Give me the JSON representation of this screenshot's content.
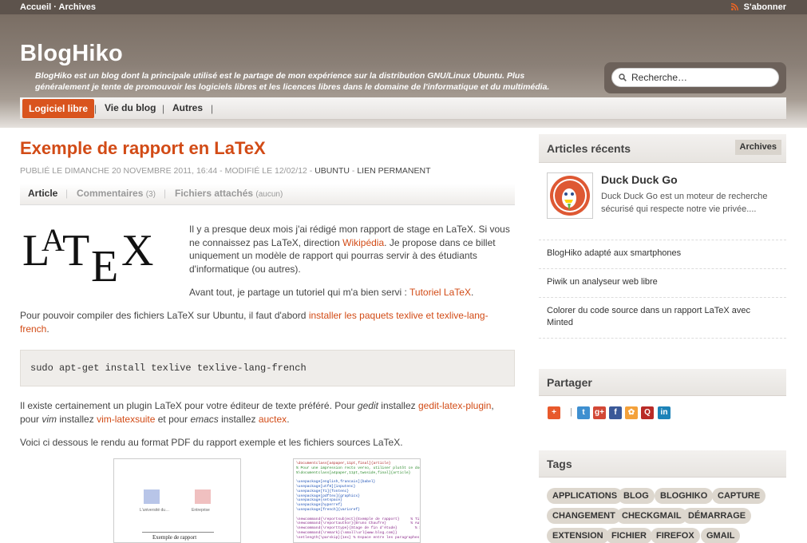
{
  "topbar": {
    "home": "Accueil",
    "dot": "·",
    "archives": "Archives",
    "subscribe": "S'abonner"
  },
  "header": {
    "title": "BlogHiko",
    "description": "BlogHiko est un blog dont la principale utilisé est le partage de mon expérience sur la distribution GNU/Linux Ubuntu. Plus généralement je tente de promouvoir les logiciels libres et les licences libres dans le domaine de l'informatique et du multimédia.",
    "search_placeholder": "Recherche…"
  },
  "nav": {
    "items": [
      "Logiciel libre",
      "Vie du blog",
      "Autres"
    ],
    "sep": "|"
  },
  "post": {
    "title": "Exemple de rapport en LaTeX",
    "meta_date": "Publié le dimanche 20 novembre 2011, 16:44 - Modifié le 12/02/12 -",
    "meta_category": "Ubuntu",
    "meta_dash": "-",
    "meta_permalink": "Lien permanent",
    "tabs": {
      "article": "Article",
      "comments": "Commentaires",
      "comments_count": "(3)",
      "files": "Fichiers attachés",
      "files_count": "(aucun)",
      "pipe": "|"
    },
    "logo_text": "LaTeX",
    "p1_a": "Il y a presque deux mois j'ai rédigé mon rapport de stage en LaTeX. Si vous ne connaissez pas LaTeX, direction ",
    "p1_link": "Wikipédia",
    "p1_b": ". Je propose dans ce billet uniquement un modèle de rapport qui pourras servir à des étudiants d'informatique (ou autres).",
    "p2_a": "Avant tout, je partage un tutoriel qui m'a bien servi : ",
    "p2_link": "Tutoriel LaTeX",
    "p2_b": ".",
    "p3_a": "Pour pouvoir compiler des fichiers LaTeX sur Ubuntu, il faut d'abord ",
    "p3_link": "installer les paquets texlive et texlive-lang-french",
    "p3_b": ".",
    "code": "sudo apt-get install texlive texlive-lang-french",
    "p4_a": "Il existe certainement un plugin LaTeX pour votre éditeur de texte préféré. Pour ",
    "p4_gedit": "gedit",
    "p4_b": " installez ",
    "p4_link1": "gedit-latex-plugin",
    "p4_c": ", pour ",
    "p4_vim": "vim",
    "p4_d": " installez ",
    "p4_link2": "vim-latexsuite",
    "p4_e": " et pour ",
    "p4_emacs": "emacs",
    "p4_f": " installez ",
    "p4_link3": "auctex",
    "p4_g": ".",
    "p5": "Voici ci dessous le rendu au format PDF du rapport exemple et les fichiers sources LaTeX.",
    "thumb_pdf": {
      "title": "Exemple de rapport",
      "caption1": "L'université du…",
      "caption2": "Entreprise"
    },
    "thumb_src": {
      "lines": [
        "\\documentclass[a4paper,11pt,final]{article}",
        "% Pour une impression recto verso, utiliser plutôt ce doc",
        "%\\documentclass[a4paper,11pt,twoside,final]{article}",
        "",
        "\\usepackage[english,francais]{babel}",
        "\\usepackage[utf8]{inputenc}",
        "\\usepackage[T1]{fontenc}",
        "\\usepackage[pdftex]{graphicx}",
        "\\usepackage{setspace}",
        "\\usepackage{hyperref}",
        "\\usepackage[french]{varioref}",
        "",
        "\\newcommand{\\reportsubject}{Exemple de rapport}     % Titre",
        "\\newcommand{\\reportauthor}{Bruno Chaufre}           % Auteur",
        "\\newcommand{\\reporttype}{Stage de fin d'étude}        % Sujet",
        "\\newcommand{\\remark}{\\small\\url{www.blog.com}}",
        "\\setlength{\\parskip}{1ex} % Espace entre les paragraphes"
      ]
    }
  },
  "sidebar": {
    "recent_title": "Articles récents",
    "archives_button": "Archives",
    "featured_title": "Duck Duck Go",
    "featured_desc": "Duck Duck Go est un moteur de recherche sécurisé qui respecte notre vie privée....",
    "recent": [
      "BlogHiko adapté aux smartphones",
      "Piwik un analyseur web libre",
      "Colorer du code source dans un rapport LaTeX avec Minted"
    ],
    "share_title": "Partager",
    "share_pipe": "|",
    "share_icons": [
      {
        "name": "addthis-icon",
        "glyph": "+",
        "color": "#e8592b"
      },
      {
        "name": "twitter-icon",
        "glyph": "t",
        "color": "#3e8fd0"
      },
      {
        "name": "google-plus-icon",
        "glyph": "g+",
        "color": "#d34836"
      },
      {
        "name": "facebook-icon",
        "glyph": "f",
        "color": "#3b5998"
      },
      {
        "name": "blogger-icon",
        "glyph": "✿",
        "color": "#f4a13a"
      },
      {
        "name": "quora-icon",
        "glyph": "Q",
        "color": "#b92b27"
      },
      {
        "name": "linkedin-icon",
        "glyph": "in",
        "color": "#1c83b8"
      }
    ],
    "tags_title": "Tags",
    "tags": [
      "APPLICATIONS",
      "BLOG",
      "BLOGHIKO",
      "CAPTURE",
      "CHANGEMENT",
      "CHECKGMAIL",
      "DÉMARRAGE",
      "EXTENSION",
      "FICHIER",
      "FIREFOX",
      "GMAIL"
    ]
  },
  "colors": {
    "accent": "#d24b16",
    "nav_active": "#d9541e",
    "header": "#7a6e64"
  }
}
